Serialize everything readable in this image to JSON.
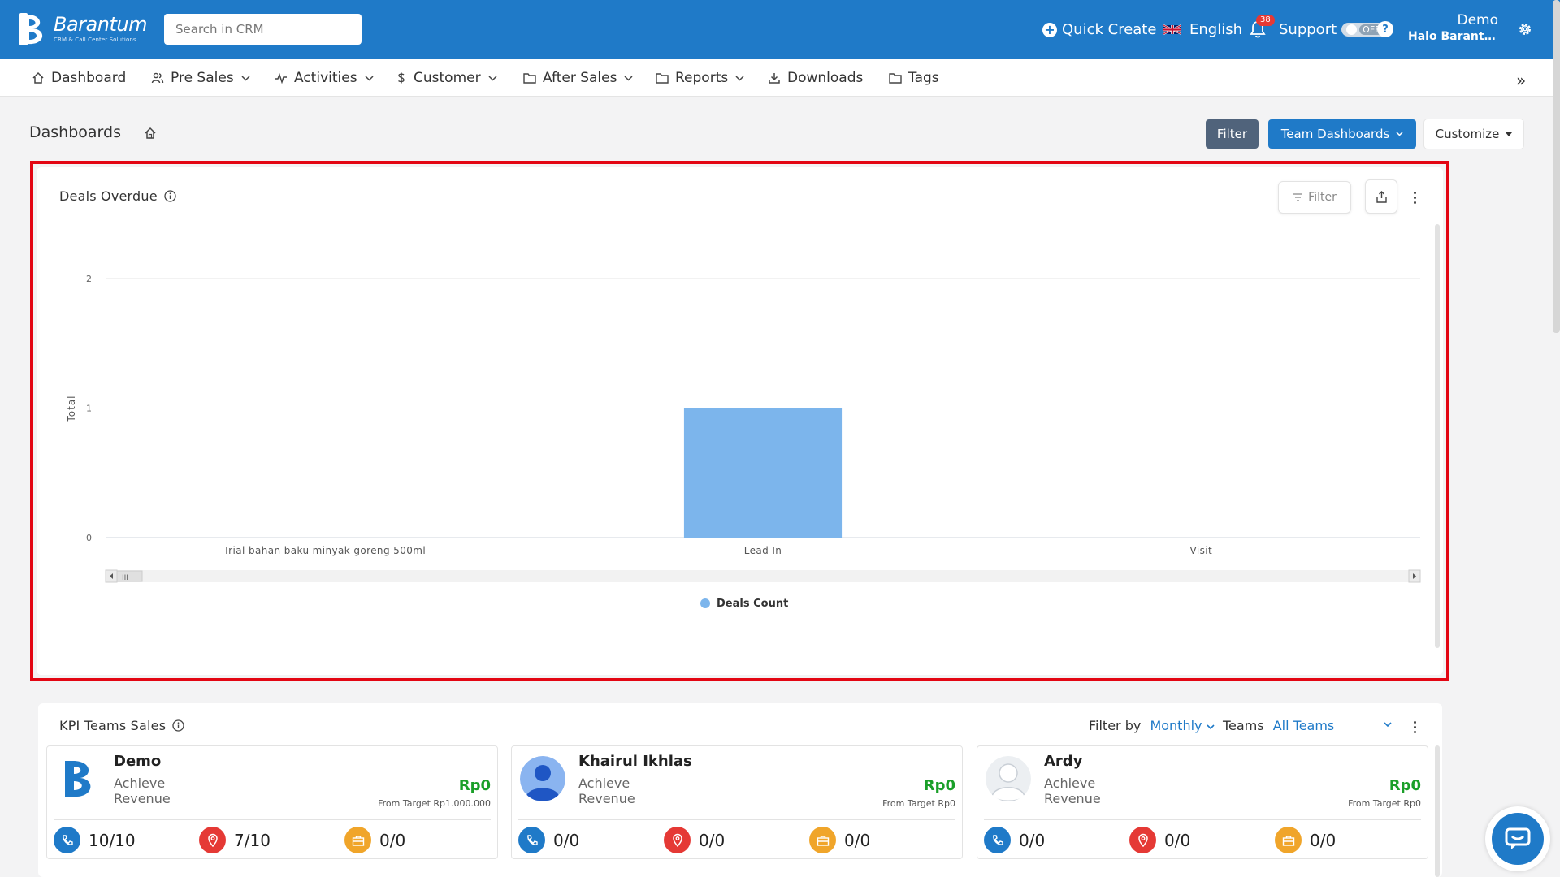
{
  "app": {
    "logo_text": "Barantum",
    "logo_sub": "CRM & Call Center Solutions",
    "search_placeholder": "Search in CRM",
    "quick_create": "Quick Create",
    "language": "English",
    "notification_count": "38",
    "support_label": "Support",
    "support_toggle": "OFF",
    "help": "?",
    "user_name": "Demo",
    "user_greeting": "Halo Barantum"
  },
  "nav": {
    "items": [
      {
        "label": "Dashboard",
        "icon": "home-icon",
        "dropdown": false
      },
      {
        "label": "Pre Sales",
        "icon": "users-icon",
        "dropdown": true
      },
      {
        "label": "Activities",
        "icon": "activity-icon",
        "dropdown": true
      },
      {
        "label": "Customer",
        "icon": "dollar-icon",
        "dropdown": true
      },
      {
        "label": "After Sales",
        "icon": "folder-icon",
        "dropdown": true
      },
      {
        "label": "Reports",
        "icon": "folder-icon",
        "dropdown": true
      },
      {
        "label": "Downloads",
        "icon": "download-icon",
        "dropdown": false
      },
      {
        "label": "Tags",
        "icon": "folder-icon",
        "dropdown": false
      }
    ],
    "more": "»"
  },
  "page": {
    "title": "Dashboards",
    "filter_button": "Filter",
    "team_dashboards_button": "Team Dashboards",
    "customize_button": "Customize"
  },
  "deals_card": {
    "title": "Deals Overdue",
    "filter_label": "Filter"
  },
  "chart_data": {
    "type": "bar",
    "title": "",
    "xlabel": "",
    "ylabel": "Total",
    "ylim": [
      0,
      2
    ],
    "yticks": [
      "0",
      "1",
      "2"
    ],
    "categories": [
      "Trial bahan baku minyak goreng 500ml",
      "Lead In",
      "Visit"
    ],
    "series": [
      {
        "name": "Deals Count",
        "values": [
          0,
          1,
          0
        ],
        "color": "#7cb5ec"
      }
    ],
    "legend": "bottom-center",
    "grid": true
  },
  "kpi_card": {
    "title": "KPI Teams Sales",
    "filter_by_label": "Filter by",
    "filter_by_value": "Monthly",
    "teams_label": "Teams",
    "teams_value": "All Teams",
    "members": [
      {
        "name": "Demo",
        "achieve": "Achieve",
        "revenue_label": "Revenue",
        "value": "Rp0",
        "target": "From Target Rp1.000.000",
        "calls": "10/10",
        "visits": "7/10",
        "deals": "0/0",
        "avatar": "barantum-logo-avatar"
      },
      {
        "name": "Khairul Ikhlas",
        "achieve": "Achieve",
        "revenue_label": "Revenue",
        "value": "Rp0",
        "target": "From Target Rp0",
        "calls": "0/0",
        "visits": "0/0",
        "deals": "0/0",
        "avatar": "blue-person-avatar"
      },
      {
        "name": "Ardy",
        "achieve": "Achieve",
        "revenue_label": "Revenue",
        "value": "Rp0",
        "target": "From Target Rp0",
        "calls": "0/0",
        "visits": "0/0",
        "deals": "0/0",
        "avatar": "grey-person-avatar"
      }
    ]
  },
  "colors": {
    "brand": "#1f7ac8",
    "highlight": "#e30613",
    "success": "#1a9f29",
    "call": "#1f7ac8",
    "visit": "#e53935",
    "deal": "#f0a52a"
  }
}
